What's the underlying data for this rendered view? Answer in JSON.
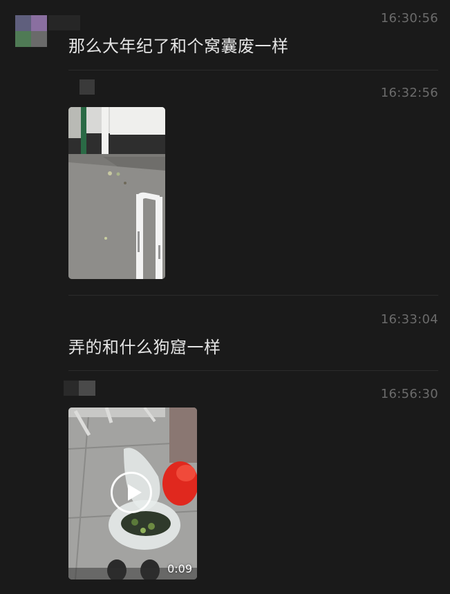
{
  "colors": {
    "background": "#1a1a1a",
    "message_text": "#e4e4e4",
    "timestamp": "#6b6b6b",
    "divider": "#2b2b2b"
  },
  "messages": [
    {
      "type": "text",
      "time": "16:30:56",
      "text": "那么大年纪了和个窝囊废一样"
    },
    {
      "type": "image",
      "time": "16:32:56"
    },
    {
      "type": "text",
      "time": "16:33:04",
      "text": "弄的和什么狗窟一样"
    },
    {
      "type": "video",
      "time": "16:56:30",
      "duration": "0:09",
      "icon": "play-icon"
    }
  ]
}
